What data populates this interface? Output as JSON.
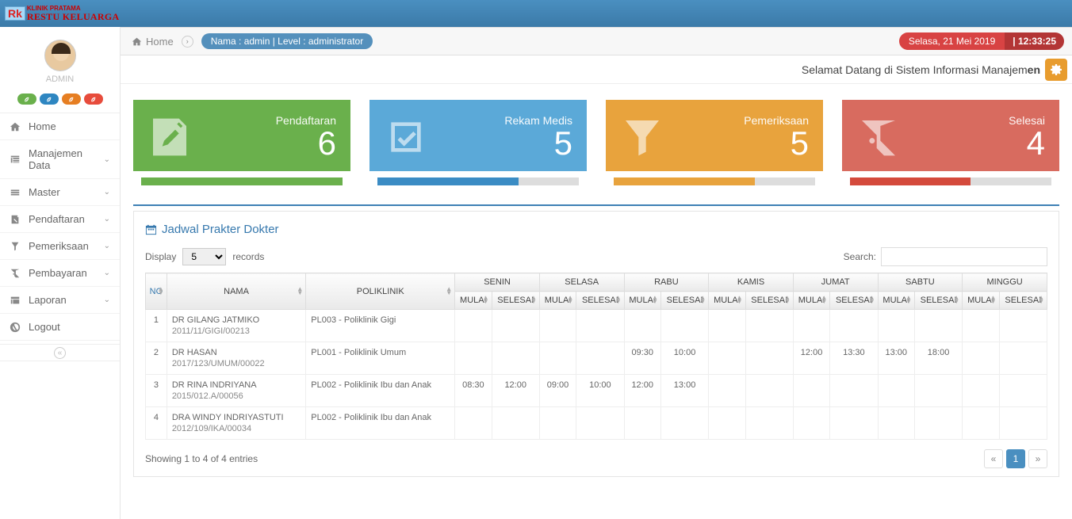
{
  "logo": {
    "line1": "KLINIK PRATAMA",
    "line2": "RESTU KELUARGA",
    "badge": "Rk"
  },
  "user": {
    "name": "ADMIN"
  },
  "breadcrumb": {
    "home": "Home",
    "pill": "Nama : admin | Level : administrator"
  },
  "datetime": {
    "date": "Selasa, 21 Mei 2019",
    "time": "| 12:33:25"
  },
  "marquee": "Selamat Datang di Sistem Informasi Manajem",
  "nav": [
    {
      "label": "Home",
      "expandable": false
    },
    {
      "label": "Manajemen Data",
      "expandable": true
    },
    {
      "label": "Master",
      "expandable": true
    },
    {
      "label": "Pendaftaran",
      "expandable": true
    },
    {
      "label": "Pemeriksaan",
      "expandable": true
    },
    {
      "label": "Pembayaran",
      "expandable": true
    },
    {
      "label": "Laporan",
      "expandable": true
    },
    {
      "label": "Logout",
      "expandable": false
    }
  ],
  "cards": [
    {
      "title": "Pendaftaran",
      "value": "6",
      "progress": 100
    },
    {
      "title": "Rekam Medis",
      "value": "5",
      "progress": 70
    },
    {
      "title": "Pemeriksaan",
      "value": "5",
      "progress": 70
    },
    {
      "title": "Selesai",
      "value": "4",
      "progress": 60
    }
  ],
  "panel": {
    "title": "Jadwal Prakter Dokter",
    "display_label": "Display",
    "records_label": "records",
    "display_value": "5",
    "search_label": "Search:",
    "headers": {
      "no": "NO",
      "nama": "NAMA",
      "poli": "POLIKLINIK",
      "days": [
        "SENIN",
        "SELASA",
        "RABU",
        "KAMIS",
        "JUMAT",
        "SABTU",
        "MINGGU"
      ],
      "mulai": "MULAI",
      "selesai": "SELESAI"
    },
    "rows": [
      {
        "no": "1",
        "nama": "DR GILANG JATMIKO",
        "sub": "2011/11/GIGI/00213",
        "poli": "PL003 - Poliklinik Gigi",
        "t": [
          "",
          "",
          "",
          "",
          "",
          "",
          "",
          "",
          "",
          "",
          "",
          "",
          "",
          ""
        ]
      },
      {
        "no": "2",
        "nama": "DR HASAN",
        "sub": "2017/123/UMUM/00022",
        "poli": "PL001 - Poliklinik Umum",
        "t": [
          "",
          "",
          "",
          "",
          "09:30",
          "10:00",
          "",
          "",
          "12:00",
          "13:30",
          "13:00",
          "18:00",
          "",
          ""
        ]
      },
      {
        "no": "3",
        "nama": "DR RINA INDRIYANA",
        "sub": "2015/012.A/00056",
        "poli": "PL002 - Poliklinik Ibu dan Anak",
        "t": [
          "08:30",
          "12:00",
          "09:00",
          "10:00",
          "12:00",
          "13:00",
          "",
          "",
          "",
          "",
          "",
          "",
          "",
          ""
        ]
      },
      {
        "no": "4",
        "nama": "DRA WINDY INDRIYASTUTI",
        "sub": "2012/109/IKA/00034",
        "poli": "PL002 - Poliklinik Ibu dan Anak",
        "t": [
          "",
          "",
          "",
          "",
          "",
          "",
          "",
          "",
          "",
          "",
          "",
          "",
          "",
          ""
        ]
      }
    ],
    "info": "Showing 1 to 4 of 4 entries",
    "pager": {
      "prev": "«",
      "page": "1",
      "next": "»"
    }
  }
}
